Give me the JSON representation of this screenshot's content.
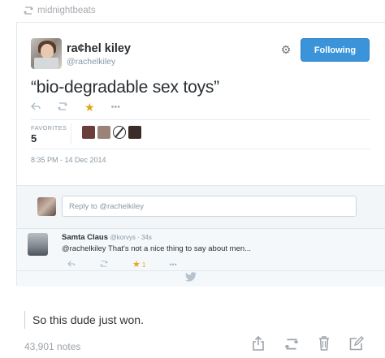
{
  "reblog": {
    "username": "midnightbeats"
  },
  "tweet": {
    "author_name": "ra¢hel kiley",
    "author_handle": "@rachelkiley",
    "follow_label": "Following",
    "text": "“bio-degradable sex toys”",
    "favorites_label": "FAVORITES",
    "favorites_count": "5",
    "timestamp": "8:35 PM - 14 Dec 2014"
  },
  "reply_box": {
    "placeholder": "Reply to @rachelkiley"
  },
  "reply": {
    "author_name": "Samta Claus",
    "author_handle": "@korvys",
    "time": "34s",
    "text": "@rachelkiley That's not a nice thing to say about men...",
    "favorite_count": "1"
  },
  "post": {
    "caption": "So this dude just won.",
    "notes": "43,901 notes"
  },
  "icons": {
    "reblog": "reblog-icon",
    "settings": "gear-icon",
    "reply": "reply-icon",
    "retweet": "retweet-icon",
    "favorite": "star-icon",
    "more": "more-icon",
    "twitter": "twitter-bird-icon",
    "share": "share-icon",
    "delete": "trash-icon",
    "edit": "edit-icon"
  },
  "colors": {
    "follow_button": "#3b94d9",
    "favorite_star": "#e2a614",
    "muted_text": "#8899a6"
  }
}
